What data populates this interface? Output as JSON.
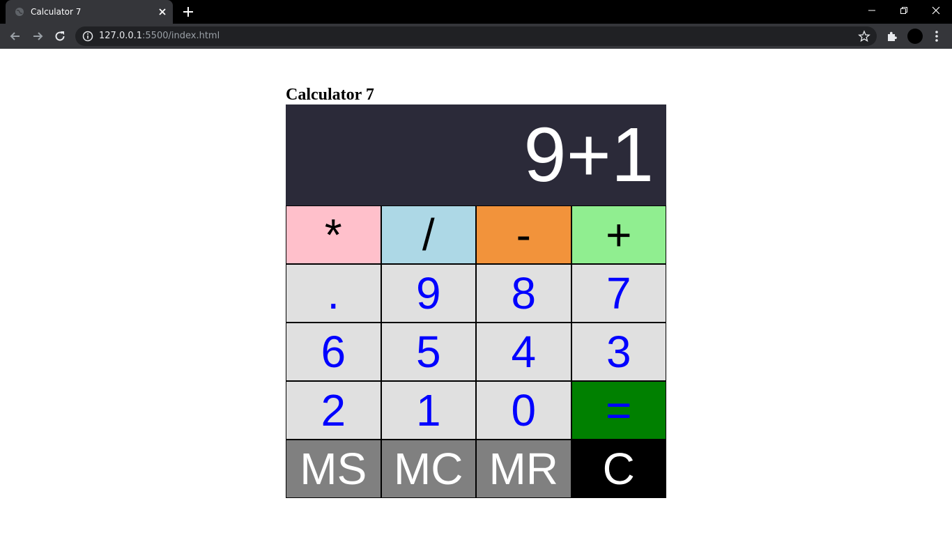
{
  "browser": {
    "tab_title": "Calculator 7",
    "url_host": "127.0.0.1",
    "url_rest": ":5500/index.html",
    "icons": {
      "favicon": "globe-icon",
      "tab_close": "close-icon",
      "new_tab": "plus-icon",
      "back": "back-arrow-icon",
      "forward": "forward-arrow-icon",
      "reload": "reload-icon",
      "site_info": "info-icon",
      "bookmark": "star-icon",
      "extensions": "puzzle-icon",
      "menu": "kebab-menu-icon"
    }
  },
  "page": {
    "heading": "Calculator 7"
  },
  "calculator": {
    "display": "9+1",
    "colors": {
      "display_bg": "#2b2a39",
      "multiply": "#ffc0cb",
      "divide": "#add8e6",
      "subtract": "#f2933b",
      "add": "#90ee90",
      "digit_bg": "#e0e0e0",
      "digit_text": "#0000ff",
      "equals_bg": "#008000",
      "memory_bg": "#808080",
      "clear_bg": "#000000"
    },
    "operators": {
      "multiply": "*",
      "divide": "/",
      "subtract": "-",
      "add": "+"
    },
    "keys": {
      "decimal": ".",
      "nine": "9",
      "eight": "8",
      "seven": "7",
      "six": "6",
      "five": "5",
      "four": "4",
      "three": "3",
      "two": "2",
      "one": "1",
      "zero": "0",
      "equals": "="
    },
    "memory": {
      "store": "MS",
      "clear_memory": "MC",
      "recall": "MR",
      "clear": "C"
    }
  }
}
